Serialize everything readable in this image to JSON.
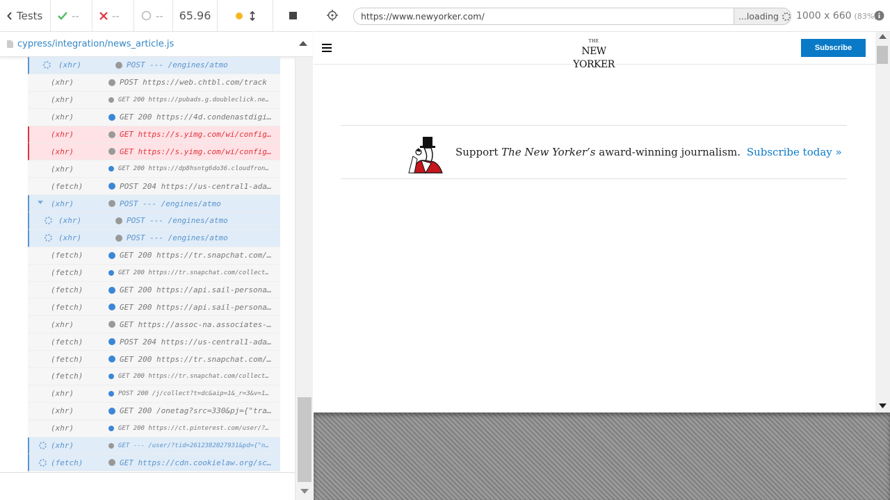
{
  "reporter": {
    "tests_label": "Tests",
    "passed": "--",
    "failed": "--",
    "pending": "--",
    "duration": "65.96",
    "spec_path": "cypress/integration/news_article.js",
    "commands": [
      {
        "kind": "(xhr)",
        "msg": "POST --- /engines/atmo",
        "state": "pending-nested",
        "dot": "gray"
      },
      {
        "kind": "(xhr)",
        "msg": "POST https://web.chtbl.com/track",
        "state": "normal",
        "dot": "gray"
      },
      {
        "kind": "(xhr)",
        "msg": "GET 200 https://pubads.g.doubleclick.ne…",
        "state": "small",
        "dot": "gray"
      },
      {
        "kind": "(xhr)",
        "msg": "GET 200 https://4d.condenastdigit…",
        "state": "normal",
        "dot": "blue"
      },
      {
        "kind": "(xhr)",
        "msg": "GET https://s.yimg.com/wi/config/…",
        "state": "failed",
        "dot": "gray"
      },
      {
        "kind": "(xhr)",
        "msg": "GET https://s.yimg.com/wi/config/…",
        "state": "failed",
        "dot": "gray"
      },
      {
        "kind": "(xhr)",
        "msg": "GET 200 https://dp8hsntg6do36.cloudfron…",
        "state": "small",
        "dot": "blue"
      },
      {
        "kind": "(fetch)",
        "msg": "POST 204 https://us-central1-adap…",
        "state": "normal",
        "dot": "blue"
      },
      {
        "kind": "(xhr)",
        "msg": "POST --- /engines/atmo",
        "state": "pending-caret",
        "dot": "gray"
      },
      {
        "kind": "(xhr)",
        "msg": "POST --- /engines/atmo",
        "state": "pending-nested2",
        "dot": "gray"
      },
      {
        "kind": "(xhr)",
        "msg": "POST --- /engines/atmo",
        "state": "pending-nested2",
        "dot": "gray"
      },
      {
        "kind": "(fetch)",
        "msg": "GET 200 https://tr.snapchat.com/c…",
        "state": "normal",
        "dot": "blue"
      },
      {
        "kind": "(fetch)",
        "msg": "GET 200 https://tr.snapchat.com/collect…",
        "state": "small",
        "dot": "blue"
      },
      {
        "kind": "(fetch)",
        "msg": "GET 200 https://api.sail-personal…",
        "state": "normal",
        "dot": "blue"
      },
      {
        "kind": "(fetch)",
        "msg": "GET 200 https://api.sail-personal…",
        "state": "normal",
        "dot": "blue"
      },
      {
        "kind": "(xhr)",
        "msg": "GET https://assoc-na.associates-a…",
        "state": "normal",
        "dot": "gray"
      },
      {
        "kind": "(fetch)",
        "msg": "POST 204 https://us-central1-adap…",
        "state": "normal",
        "dot": "blue"
      },
      {
        "kind": "(fetch)",
        "msg": "GET 200 https://tr.snapchat.com/c…",
        "state": "normal",
        "dot": "blue"
      },
      {
        "kind": "(fetch)",
        "msg": "GET 200 https://tr.snapchat.com/collect…",
        "state": "small",
        "dot": "blue"
      },
      {
        "kind": "(xhr)",
        "msg": "POST 200 /j/collect?t=dc&aip=1&_r=3&v=1…",
        "state": "small",
        "dot": "blue"
      },
      {
        "kind": "(xhr)",
        "msg": "GET 200 /onetag?src=330&pj={\"trac…",
        "state": "normal",
        "dot": "blue"
      },
      {
        "kind": "(xhr)",
        "msg": "GET 200 https://ct.pinterest.com/user/?…",
        "state": "small",
        "dot": "blue"
      },
      {
        "kind": "(xhr)",
        "msg": "GET --- /user/?tid=2612382027931&pd={\"n…",
        "state": "pending-small",
        "dot": "gray"
      },
      {
        "kind": "(fetch)",
        "msg": "GET https://cdn.cookielaw.org/scr…",
        "state": "pending",
        "dot": "gray"
      }
    ]
  },
  "aut": {
    "url": "https://www.newyorker.com/",
    "loading": "...loading",
    "viewport": "1000 x 660",
    "scale": "(83%)",
    "logo_the": "THE",
    "logo_name": "NEW YORKER",
    "subscribe": "Subscribe",
    "promo_support": "Support",
    "promo_pub": "The New Yorker’s",
    "promo_rest": "award-winning journalism.",
    "promo_link": "Subscribe today »"
  },
  "colors": {
    "accent": "#3386c4",
    "fail": "#e0333e",
    "pass": "#4dbb5f",
    "subscribe_blue": "#0a7ac7"
  },
  "icons": [
    "chevron-left-icon",
    "check-icon",
    "x-icon",
    "circle-icon",
    "stop-icon",
    "file-icon",
    "crosshair-icon",
    "info-icon",
    "hamburger-icon"
  ]
}
